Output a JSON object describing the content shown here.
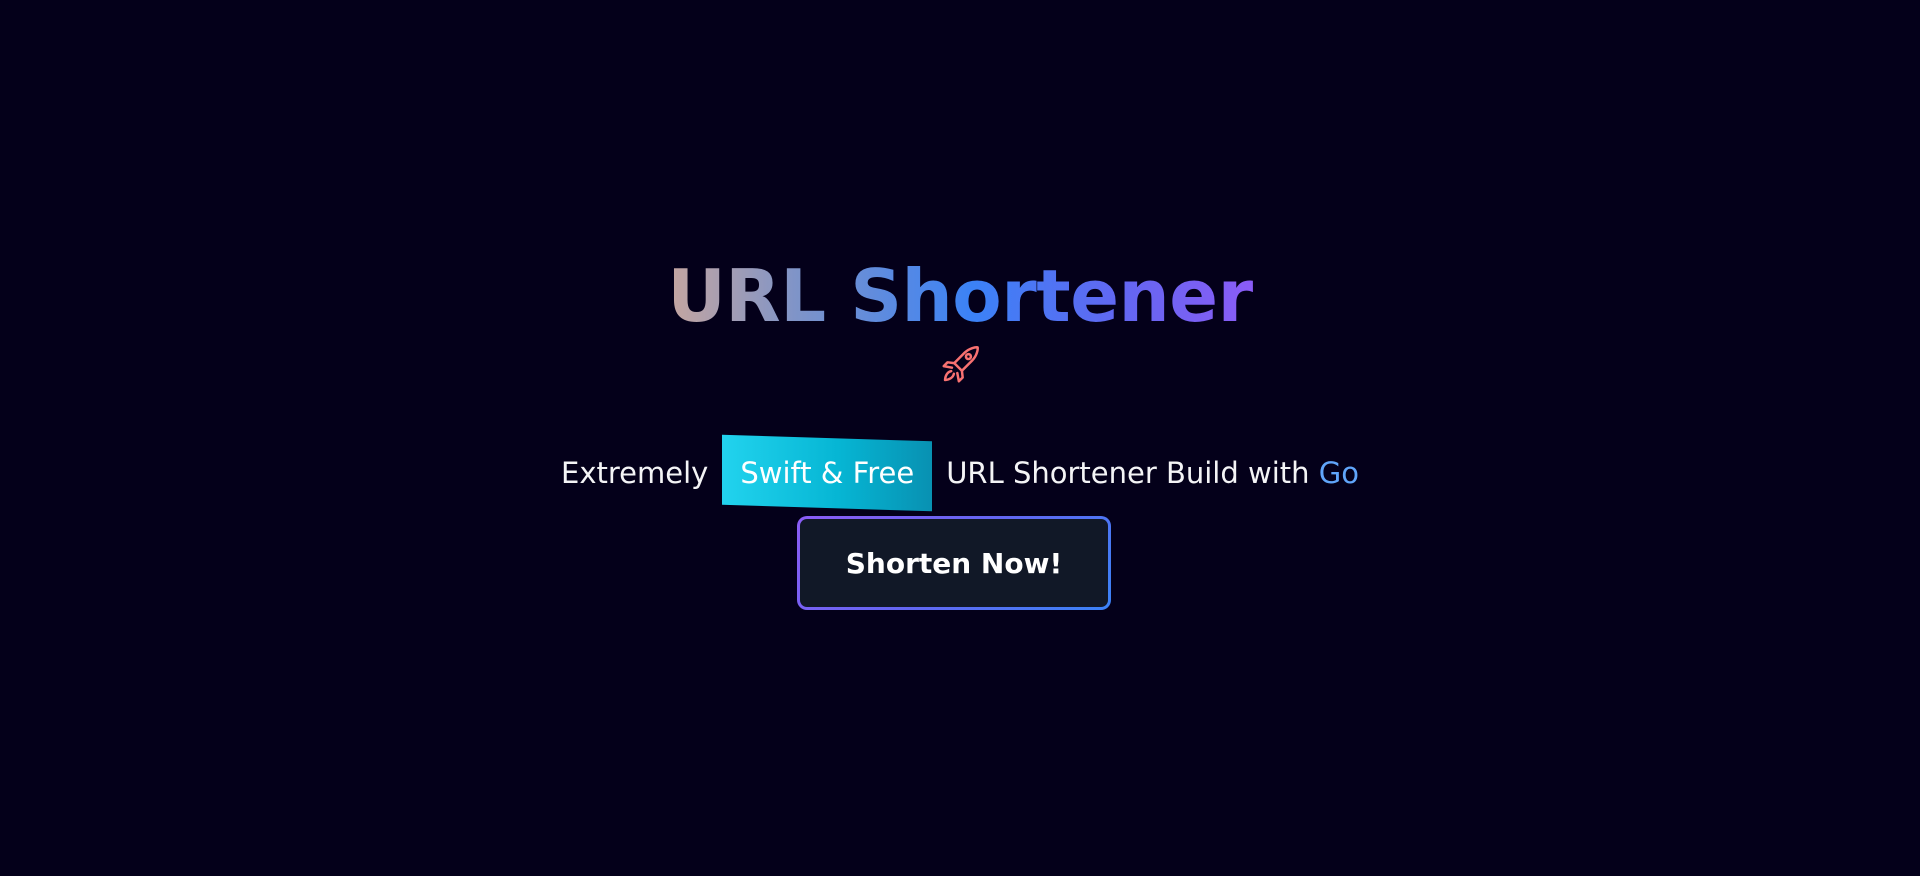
{
  "hero": {
    "title": "URL Shortener",
    "rocket_icon": "rocket-icon",
    "subtitle": {
      "prefix": "Extremely",
      "highlight": "Swift & Free",
      "middle": "URL Shortener Build with",
      "accent": "Go"
    },
    "cta_label": "Shorten Now!"
  },
  "colors": {
    "background": "#04001a",
    "title_gradient": [
      "#c6a6a0",
      "#3b82f6",
      "#8b5cf6"
    ],
    "highlight_bg": "#06b6d4",
    "go_accent": "#60a5fa",
    "rocket": "#f87171",
    "button_bg": "#111827",
    "button_border": "#6366f1"
  }
}
